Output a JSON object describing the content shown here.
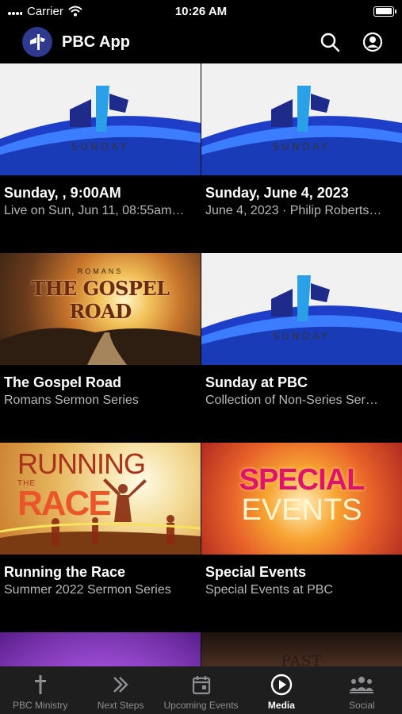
{
  "status_bar": {
    "carrier": "Carrier",
    "time": "10:26 AM",
    "battery_level": 1.0
  },
  "header": {
    "title": "PBC App",
    "icons": [
      "app-logo-icon",
      "search-icon",
      "account-icon"
    ]
  },
  "cards": [
    {
      "title": "Sunday, , 9:00AM",
      "subtitle": "Live on Sun, Jun 11, 08:55am…",
      "thumb_text": "SUNDAY"
    },
    {
      "title": "Sunday, June 4, 2023",
      "subtitle": "June 4, 2023 · Philip Roberts…",
      "thumb_text": "SUNDAY"
    },
    {
      "title": "The Gospel Road",
      "subtitle": "Romans Sermon Series",
      "thumb_kicker": "ROMANS",
      "thumb_text": "THE GOSPEL ROAD"
    },
    {
      "title": "Sunday at PBC",
      "subtitle": "Collection of Non-Series Ser…",
      "thumb_text": "SUNDAY"
    },
    {
      "title": "Running the Race",
      "subtitle": "Summer 2022 Sermon Series",
      "thumb_line1": "RUNNING",
      "thumb_line2": "THE",
      "thumb_line3": "RACE"
    },
    {
      "title": "Special Events",
      "subtitle": "Special Events at PBC",
      "thumb_line1": "SPECIAL",
      "thumb_line2": "EVENTS"
    },
    {
      "thumb_text": ""
    },
    {
      "thumb_text": "PAST"
    }
  ],
  "tabs": [
    {
      "label": "PBC Ministry",
      "icon": "cross-icon",
      "active": false
    },
    {
      "label": "Next Steps",
      "icon": "double-chevron-icon",
      "active": false
    },
    {
      "label": "Upcoming Events",
      "icon": "calendar-icon",
      "active": false
    },
    {
      "label": "Media",
      "icon": "play-circle-icon",
      "active": true
    },
    {
      "label": "Social",
      "icon": "group-icon",
      "active": false
    }
  ],
  "colors": {
    "background": "#000000",
    "tabbar": "#1e1e1e",
    "brand_blue": "#2f3a8f",
    "subtitle_gray": "#b8b8b8",
    "inactive_tab": "#8e8e93"
  }
}
